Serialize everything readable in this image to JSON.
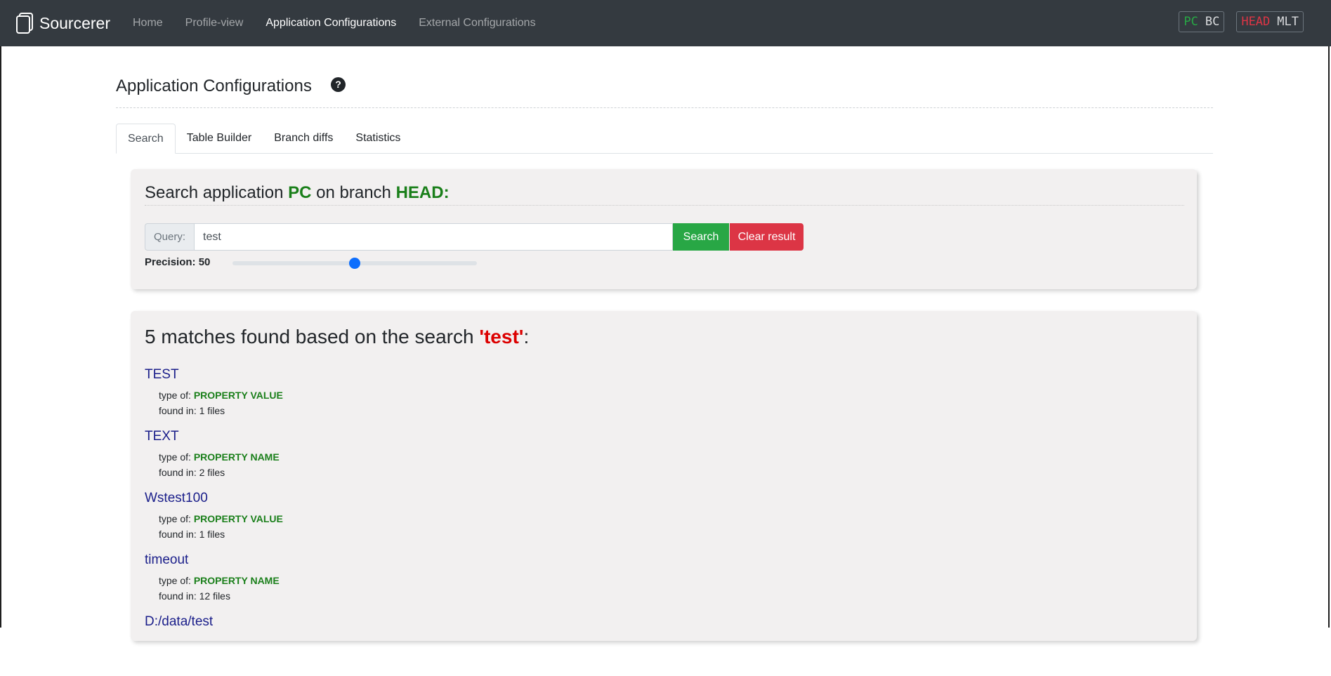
{
  "navbar": {
    "brand": "Sourcerer",
    "links": [
      "Home",
      "Profile-view",
      "Application Configurations",
      "External Configurations"
    ],
    "active_index": 2,
    "app_badge": {
      "active": "PC",
      "other": "BC"
    },
    "branch_badge": {
      "active": "HEAD",
      "other": "MLT"
    }
  },
  "page": {
    "title": "Application Configurations",
    "help": "?"
  },
  "tabs": [
    "Search",
    "Table Builder",
    "Branch diffs",
    "Statistics"
  ],
  "search": {
    "heading_prefix": "Search application ",
    "app": "PC",
    "heading_mid": " on branch ",
    "branch": "HEAD:",
    "query_label": "Query:",
    "query_value": "test",
    "search_button": "Search",
    "clear_button": "Clear result",
    "precision_label": "Precision: 50",
    "precision_fraction": 0.5
  },
  "results": {
    "heading_prefix": "5 matches found based on the search ",
    "term": "'test'",
    "heading_suffix": ":",
    "type_prefix": "type of: ",
    "found_prefix": "found in: ",
    "items": [
      {
        "name": "TEST",
        "type": "PROPERTY VALUE",
        "found": "1 files"
      },
      {
        "name": "TEXT",
        "type": "PROPERTY NAME",
        "found": "2 files"
      },
      {
        "name": "Wstest100",
        "type": "PROPERTY VALUE",
        "found": "1 files"
      },
      {
        "name": "timeout",
        "type": "PROPERTY NAME",
        "found": "12 files"
      },
      {
        "name": "D:/data/test",
        "type": "",
        "found": ""
      }
    ]
  }
}
